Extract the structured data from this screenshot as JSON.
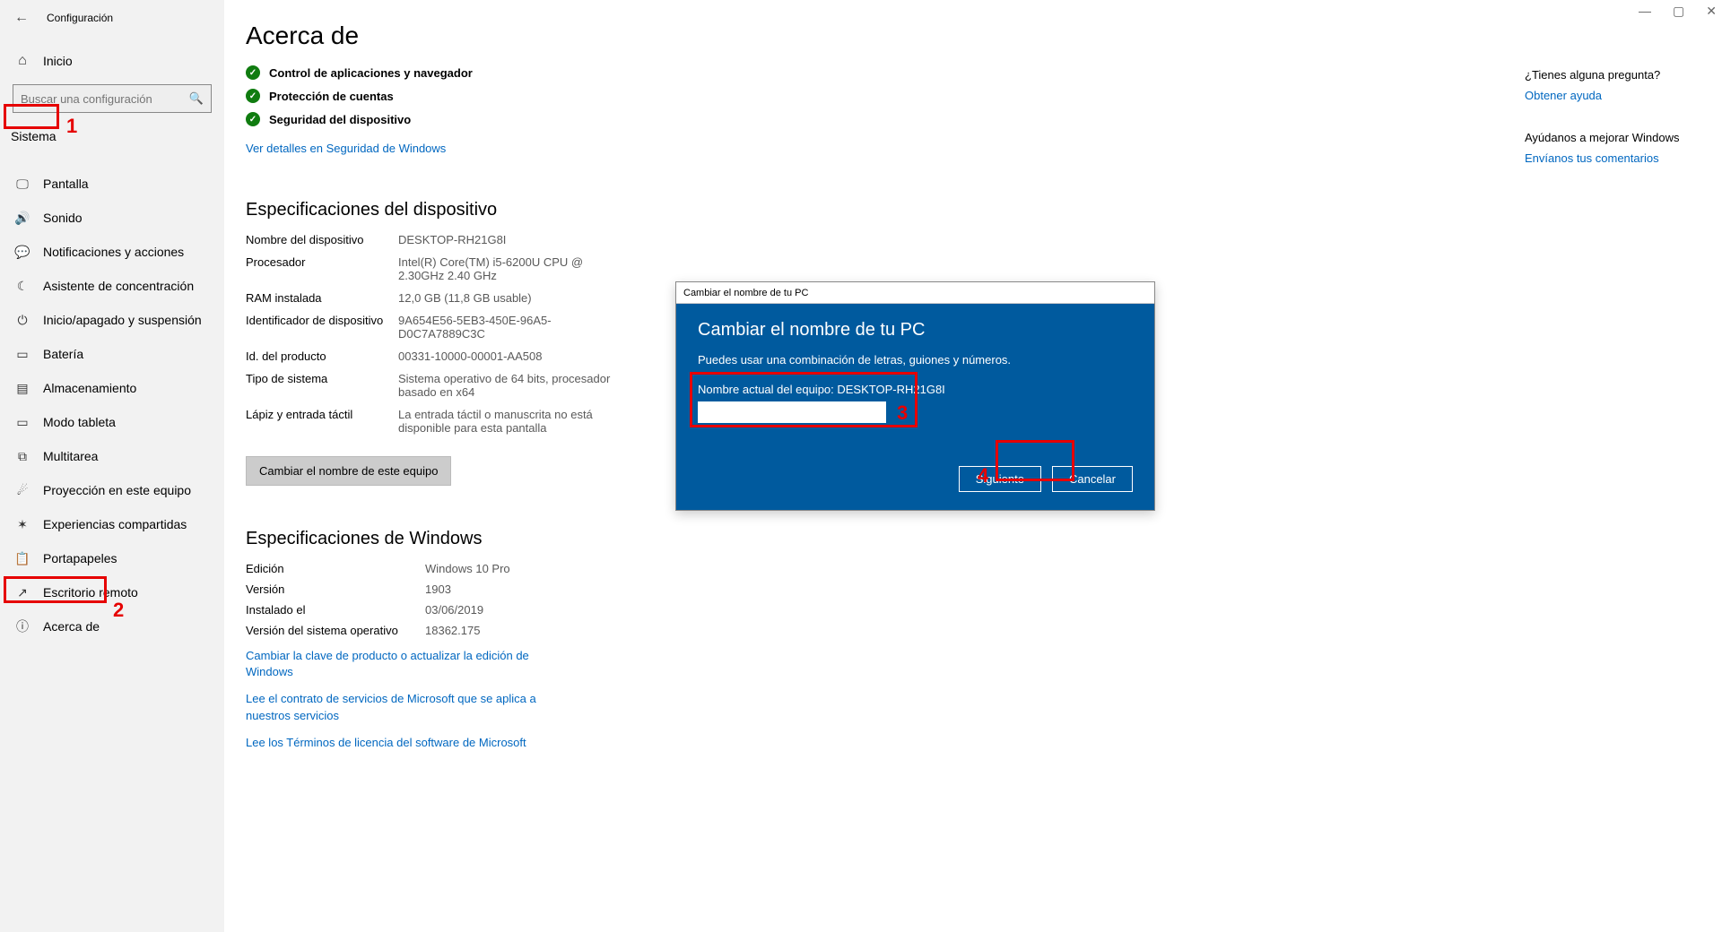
{
  "header": {
    "back": "←",
    "app_title": "Configuración"
  },
  "titlebar": {
    "min": "—",
    "max": "▢",
    "close": "✕"
  },
  "home": {
    "label": "Inicio"
  },
  "search": {
    "placeholder": "Buscar una configuración"
  },
  "category": {
    "label": "Sistema"
  },
  "nav": [
    {
      "icon": "display-icon",
      "glyph": "🖵",
      "label": "Pantalla"
    },
    {
      "icon": "sound-icon",
      "glyph": "🔊",
      "label": "Sonido"
    },
    {
      "icon": "notifications-icon",
      "glyph": "💬",
      "label": "Notificaciones y acciones"
    },
    {
      "icon": "focus-icon",
      "glyph": "☾",
      "label": "Asistente de concentración"
    },
    {
      "icon": "power-icon",
      "glyph": "⏻",
      "label": "Inicio/apagado y suspensión"
    },
    {
      "icon": "battery-icon",
      "glyph": "▭",
      "label": "Batería"
    },
    {
      "icon": "storage-icon",
      "glyph": "▤",
      "label": "Almacenamiento"
    },
    {
      "icon": "tablet-icon",
      "glyph": "▭",
      "label": "Modo tableta"
    },
    {
      "icon": "multitask-icon",
      "glyph": "⧉",
      "label": "Multitarea"
    },
    {
      "icon": "project-icon",
      "glyph": "☄",
      "label": "Proyección en este equipo"
    },
    {
      "icon": "shared-icon",
      "glyph": "✶",
      "label": "Experiencias compartidas"
    },
    {
      "icon": "clipboard-icon",
      "glyph": "📋",
      "label": "Portapapeles"
    },
    {
      "icon": "remote-icon",
      "glyph": "↗",
      "label": "Escritorio remoto"
    },
    {
      "icon": "about-icon",
      "glyph": "ⓘ",
      "label": "Acerca de"
    }
  ],
  "page": {
    "title": "Acerca de",
    "security": [
      "Control de aplicaciones y navegador",
      "Protección de cuentas",
      "Seguridad del dispositivo"
    ],
    "security_link": "Ver detalles en Seguridad de Windows",
    "device_spec_title": "Especificaciones del dispositivo",
    "device_specs": [
      {
        "label": "Nombre del dispositivo",
        "value": "DESKTOP-RH21G8I"
      },
      {
        "label": "Procesador",
        "value": "Intel(R) Core(TM) i5-6200U CPU @ 2.30GHz   2.40 GHz"
      },
      {
        "label": "RAM instalada",
        "value": "12,0 GB (11,8 GB usable)"
      },
      {
        "label": "Identificador de dispositivo",
        "value": "9A654E56-5EB3-450E-96A5-D0C7A7889C3C"
      },
      {
        "label": "Id. del producto",
        "value": "00331-10000-00001-AA508"
      },
      {
        "label": "Tipo de sistema",
        "value": "Sistema operativo de 64 bits, procesador basado en x64"
      },
      {
        "label": "Lápiz y entrada táctil",
        "value": "La entrada táctil o manuscrita no está disponible para esta pantalla"
      }
    ],
    "rename_button": "Cambiar el nombre de este equipo",
    "win_spec_title": "Especificaciones de Windows",
    "win_specs": [
      {
        "label": "Edición",
        "value": "Windows 10 Pro"
      },
      {
        "label": "Versión",
        "value": "1903"
      },
      {
        "label": "Instalado el",
        "value": "03/06/2019"
      },
      {
        "label": "Versión del sistema operativo",
        "value": "18362.175"
      }
    ],
    "win_links": [
      "Cambiar la clave de producto o actualizar la edición de Windows",
      "Lee el contrato de servicios de Microsoft que se aplica a nuestros servicios",
      "Lee los Términos de licencia del software de Microsoft"
    ]
  },
  "right_pane": {
    "q_heading": "¿Tienes alguna pregunta?",
    "q_link": "Obtener ayuda",
    "improve_heading": "Ayúdanos a mejorar Windows",
    "improve_link": "Envíanos tus comentarios"
  },
  "dialog": {
    "titlebar": "Cambiar el nombre de tu PC",
    "heading": "Cambiar el nombre de tu PC",
    "desc": "Puedes usar una combinación de letras, guiones y números.",
    "current_label": "Nombre actual del equipo: DESKTOP-RH21G8I",
    "next": "Siguiente",
    "cancel": "Cancelar"
  },
  "annotations": {
    "n1": "1",
    "n2": "2",
    "n3": "3",
    "n4": "4"
  }
}
